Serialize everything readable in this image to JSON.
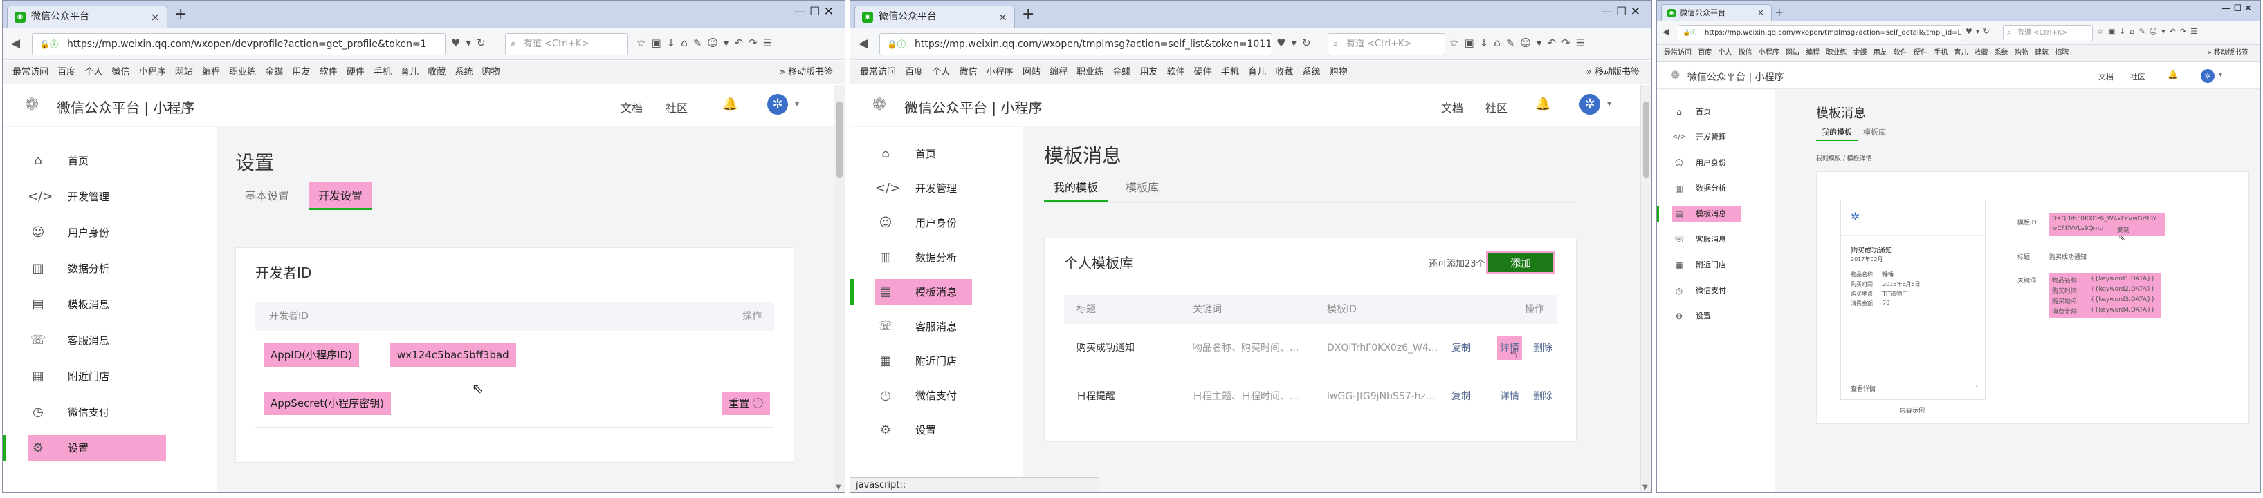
{
  "common": {
    "brand": "微信公众平台 | 小程序",
    "docs": "文档",
    "community": "社区",
    "tab_close": "×",
    "new_tab": "+",
    "win_controls": "—   ☐   ✕",
    "search_placeholder": "有道 <Ctrl+K>",
    "bookmarks": [
      "最常访问",
      "百度",
      "个人",
      "微信",
      "小程序",
      "网站",
      "编程",
      "职业练",
      "金蝶",
      "用友",
      "软件",
      "硬件",
      "手机",
      "育儿",
      "收藏",
      "系统",
      "购物",
      "建筑",
      "招聘"
    ],
    "bookmarks_more": "» 移动版书签",
    "menu": [
      "首页",
      "开发管理",
      "用户身份",
      "数据分析",
      "模板消息",
      "客服消息",
      "附近门店",
      "微信支付",
      "设置"
    ],
    "menu_icons": [
      "home-icon",
      "code-icon",
      "user-icon",
      "chart-icon",
      "template-icon",
      "chat-icon",
      "store-icon",
      "pay-icon",
      "gear-icon"
    ],
    "accent": "#1aad19",
    "highlight": "#f7a3d2"
  },
  "win1": {
    "tab_title": "微信公众平台",
    "url": "https://mp.weixin.qq.com/wxopen/devprofile?action=get_profile&token=1",
    "page_title": "设置",
    "tabs": [
      "基本设置",
      "开发设置"
    ],
    "section_title": "开发者ID",
    "header_col1": "开发者ID",
    "header_col2": "操作",
    "row1_label": "AppID(小程序ID)",
    "row1_value": "wx124c5bac5bff3bad",
    "row2_label": "AppSecret(小程序密钥)",
    "row2_action": "重置 ⓘ"
  },
  "win2": {
    "tab_title": "微信公众平台",
    "url": "https://mp.weixin.qq.com/wxopen/tmplmsg?action=self_list&token=10114",
    "page_title": "模板消息",
    "tabs": [
      "我的模板",
      "模板库"
    ],
    "section_title": "个人模板库",
    "remaining": "还可添加23个",
    "add_button": "添加",
    "headers": [
      "标题",
      "关键词",
      "模板ID",
      "操作"
    ],
    "rows": [
      {
        "title": "购买成功通知",
        "keywords": "物品名称、购买时间、...",
        "id": "DXQiTrhF0KX0z6_W4...",
        "a1": "复制",
        "a2": "详情",
        "a3": "删除"
      },
      {
        "title": "日程提醒",
        "keywords": "日程主题、日程时间、...",
        "id": "lwGG-JfG9jNbSS7-hz...",
        "a1": "复制",
        "a2": "详情",
        "a3": "删除"
      }
    ],
    "status": "javascript:;"
  },
  "win3": {
    "tab_title": "微信公众平台",
    "url": "https://mp.weixin.qq.com/wxopen/tmplmsg?action=self_detail&tmpl_id=D",
    "page_title": "模板消息",
    "tabs": [
      "我的模板",
      "模板库"
    ],
    "breadcrumb": "我的模板 / 模板详情",
    "preview_title": "购买成功通知",
    "preview_date": "2017年02月",
    "preview_fields": [
      {
        "k": "物品名称",
        "v": "锤锤"
      },
      {
        "k": "购买时间",
        "v": "2016年6月6日"
      },
      {
        "k": "购买地点",
        "v": "TIT造物厂"
      },
      {
        "k": "消费金额",
        "v": "70"
      }
    ],
    "preview_more": "查看详情",
    "preview_caption": "内容示例",
    "id_label": "模板ID",
    "id_value_1": "DXQiTrhF0KX0z6_W4xEcVwGr9RY",
    "id_value_2": "wCFKVVLs9Qmg",
    "id_copy": "复制",
    "title_label": "标题",
    "title_value": "购买成功通知",
    "kw_label": "关键词",
    "keywords": [
      {
        "k": "物品名称",
        "v": "{{keyword1.DATA}}"
      },
      {
        "k": "购买时间",
        "v": "{{keyword2.DATA}}"
      },
      {
        "k": "购买地点",
        "v": "{{keyword3.DATA}}"
      },
      {
        "k": "消费金额",
        "v": "{{keyword4.DATA}}"
      }
    ]
  }
}
